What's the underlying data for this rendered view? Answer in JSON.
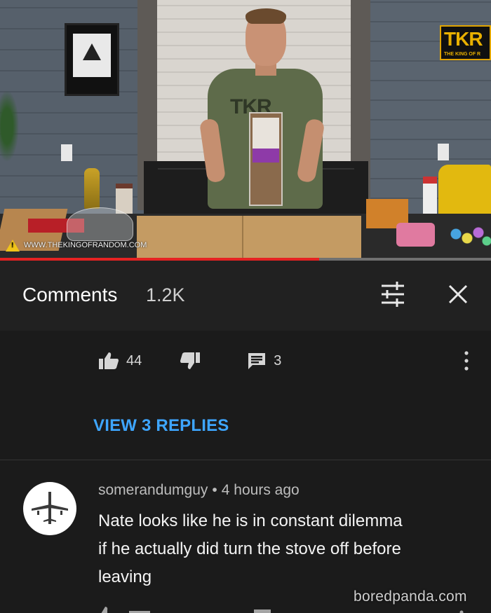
{
  "video": {
    "watermark": "WWW.THEKINGOFRANDOM.COM",
    "progress_percent": 65,
    "sign_logo": "TKR",
    "sign_subtitle": "THE KING OF R",
    "shirt_logo": "TKR"
  },
  "comments_header": {
    "title": "Comments",
    "count": "1.2K",
    "icons": {
      "sort": "sort-filter-icon",
      "close": "close-icon"
    }
  },
  "previous_comment": {
    "likes": "44",
    "replies": "3",
    "view_replies": "VIEW 3 REPLIES",
    "icons": {
      "like": "thumbs-up-icon",
      "dislike": "thumbs-down-icon",
      "reply": "comment-icon",
      "more": "more-vert-icon"
    }
  },
  "comment": {
    "author": "somerandumguy",
    "separator": "•",
    "time": "4 hours ago",
    "avatar": "airplane-avatar",
    "lines": [
      "Nate looks like he is in constant dilemma",
      "if he actually did turn the stove off before",
      "leaving"
    ]
  },
  "credit": "boredpanda.com",
  "colors": {
    "background": "#1b1b1b",
    "header_bg": "#212121",
    "link_blue": "#3ea6ff",
    "progress_red": "#e52222"
  }
}
